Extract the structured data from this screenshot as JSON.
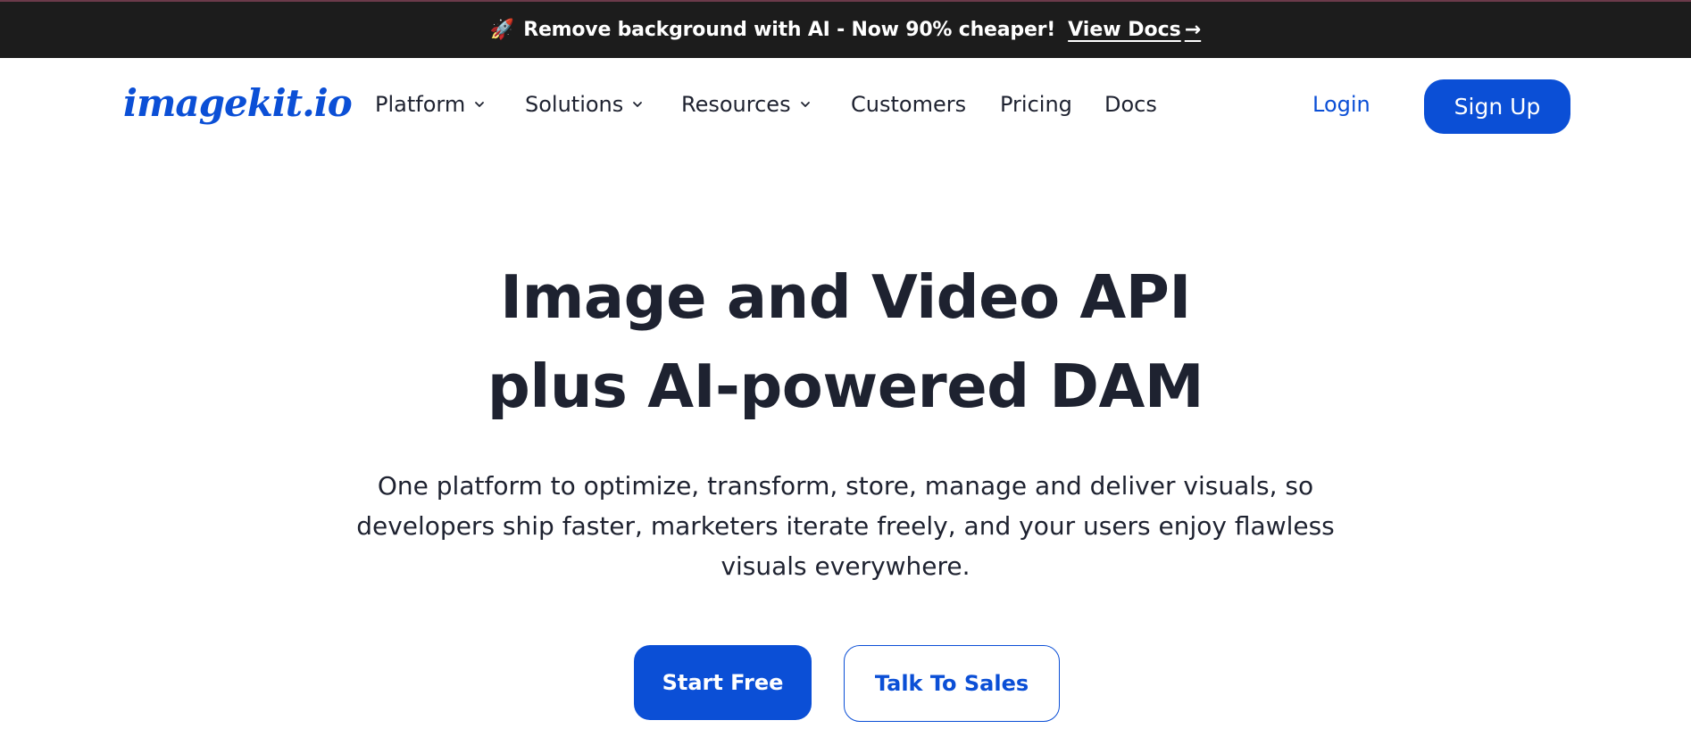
{
  "announcement": {
    "icon": "rocket-icon",
    "message": "Remove background with AI - Now 90% cheaper!",
    "link_label": "View Docs",
    "link_arrow": "→"
  },
  "nav": {
    "logo": "imagekit.io",
    "items": [
      {
        "label": "Platform",
        "has_dropdown": true
      },
      {
        "label": "Solutions",
        "has_dropdown": true
      },
      {
        "label": "Resources",
        "has_dropdown": true
      },
      {
        "label": "Customers",
        "has_dropdown": false
      },
      {
        "label": "Pricing",
        "has_dropdown": false
      },
      {
        "label": "Docs",
        "has_dropdown": false
      }
    ],
    "login": "Login",
    "signup": "Sign Up"
  },
  "hero": {
    "title_line1": "Image and Video API",
    "title_line2": "plus AI-powered DAM",
    "subtitle": "One platform to optimize, transform, store, manage and deliver visuals, so developers ship faster, marketers iterate freely, and your users enjoy flawless visuals everywhere.",
    "primary_cta": "Start Free",
    "secondary_cta": "Talk To Sales"
  },
  "colors": {
    "brand": "#0b4fd6",
    "text": "#1e2230",
    "announce_bg": "#1c1c1c"
  }
}
